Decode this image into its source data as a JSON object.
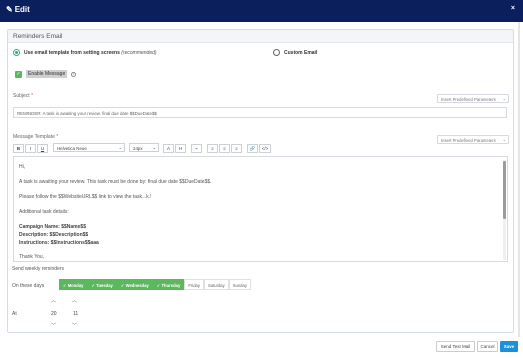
{
  "titlebar": {
    "title": "Edit",
    "close": "×"
  },
  "panel": {
    "heading": "Reminders Email"
  },
  "options": {
    "template_label": "Use email template from setting screens",
    "template_note": "(recommended)",
    "custom_label": "Custom Email"
  },
  "enable": {
    "check": "✓",
    "label": "Enable Message",
    "info": "i"
  },
  "subject": {
    "label": "Subject",
    "required": "*",
    "value": "REMINDER: A task is awaiting your review. final due date $$DueDate$$",
    "predef": "Insert Predefined Parameters"
  },
  "template": {
    "label": "Message Template",
    "required": "*",
    "predef": "Insert Predefined Parameters",
    "font": "Helvetica Neue",
    "size": "24px",
    "buttons": [
      "B",
      "I",
      "U",
      "A",
      "H",
      "⌁",
      "≡",
      "≡",
      "≡",
      "🔗",
      "</>"
    ]
  },
  "body": {
    "l1": "Hi,",
    "l2": "A task is awaiting your review. This task must be done by: final due date $$DueDate$$.",
    "l3": "Please follow the $$WebsiteURL$$ link to view the task...k.!",
    "l4": "Additional task details:",
    "campaign_label": "Campaign Name:",
    "campaign_val": " $$Name$$",
    "desc_label": "Description:",
    "desc_val": " $$Description$$",
    "instr_label": "Instructions:",
    "instr_val": " $$Instructions$$aaa",
    "l8": "Thank You,"
  },
  "weekly": {
    "heading": "Send weekly reminders",
    "days_label": "On these days",
    "days": [
      {
        "label": "Monday",
        "on": true
      },
      {
        "label": "Tuesday",
        "on": true
      },
      {
        "label": "Wednesday",
        "on": true
      },
      {
        "label": "Thursday",
        "on": true
      },
      {
        "label": "Friday",
        "on": false
      },
      {
        "label": "Saturday",
        "on": false
      },
      {
        "label": "Sunday",
        "on": false
      }
    ],
    "at_label": "At",
    "hour": "20",
    "minute": "11"
  },
  "footer": {
    "test": "Send Test Mail",
    "cancel": "Cancel",
    "save": "Save"
  },
  "colors": {
    "titlebar": "#0a1f5c",
    "accent_green": "#5cb85c",
    "save_blue": "#1e90d8"
  }
}
